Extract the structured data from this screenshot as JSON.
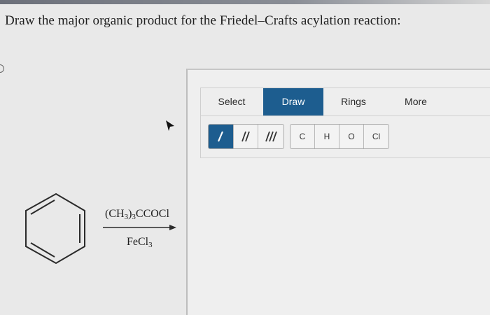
{
  "question": {
    "text": "Draw the major organic product for the Friedel–Crafts acylation reaction:"
  },
  "reaction": {
    "reagent_top": {
      "main": "(CH",
      "s1": "3",
      "mid": ")",
      "s2": "3",
      "tail": "CCOCl"
    },
    "reagent_bottom": {
      "main": "FeCl",
      "s1": "3"
    }
  },
  "toolbar": {
    "tabs": [
      {
        "label": "Select",
        "active": false
      },
      {
        "label": "Draw",
        "active": true
      },
      {
        "label": "Rings",
        "active": false
      },
      {
        "label": "More",
        "active": false
      }
    ],
    "bond_tools": [
      {
        "icon": "single-bond-icon",
        "active": true
      },
      {
        "icon": "double-bond-icon",
        "active": false
      },
      {
        "icon": "triple-bond-icon",
        "active": false
      }
    ],
    "atom_tools": [
      "C",
      "H",
      "O",
      "Cl"
    ]
  },
  "colors": {
    "accent": "#1d5d8f",
    "background": "#e9e9e9",
    "text": "#1e1e1e"
  }
}
